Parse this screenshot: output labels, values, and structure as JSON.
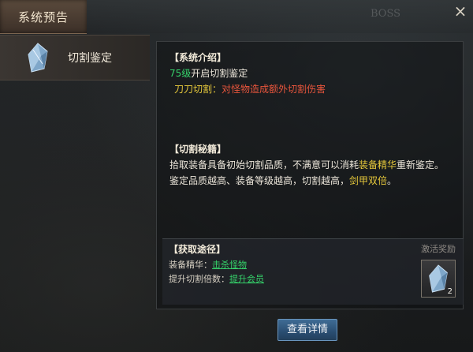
{
  "title_tab": "系统预告",
  "background_text": "BOSS",
  "close_icon": "×",
  "sidebar": {
    "items": [
      {
        "label": "切割鉴定",
        "icon": "gem-icon"
      }
    ]
  },
  "intro": {
    "heading": "【系统介绍】",
    "level_text": "75级",
    "level_suffix": "开启切割鉴定",
    "feature_name": "刀刀切割",
    "feature_sep": "：",
    "feature_desc": "对怪物造成额外切割伤害"
  },
  "secret": {
    "heading": "【切割秘籍】",
    "line1_a": "拾取装备具备初始切割品质，不满意可以消耗",
    "line1_b": "装备精华",
    "line1_c": "重新鉴定。",
    "line2_a": "鉴定品质越高、装备等级越高，切割越高，",
    "line2_b": "剑甲双倍",
    "line2_c": "。"
  },
  "acquire": {
    "heading": "【获取途径】",
    "row1_label": "装备精华：",
    "row1_link": "击杀怪物",
    "row2_label": "提升切割倍数：",
    "row2_link": "提升会员",
    "reward_title": "激活奖励",
    "reward_count": "2"
  },
  "detail_button": "查看详情",
  "colors": {
    "green": "#35d26a",
    "yellow": "#e7c93b",
    "red": "#e8553c",
    "button": "#2a4e72"
  }
}
